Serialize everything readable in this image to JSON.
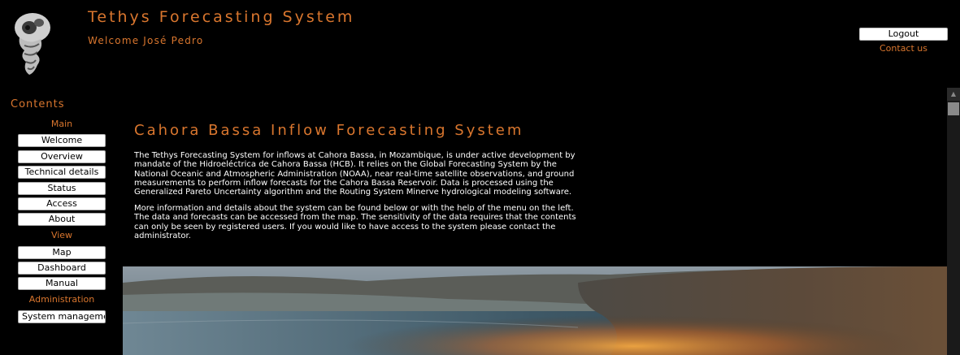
{
  "header": {
    "title": "Tethys Forecasting System",
    "welcome": "Welcome José Pedro",
    "logout_label": "Logout",
    "contact_label": "Contact us"
  },
  "sidebar": {
    "heading": "Contents",
    "groups": [
      {
        "label": "Main",
        "items": [
          "Welcome",
          "Overview",
          "Technical details",
          "Status",
          "Access",
          "About"
        ]
      },
      {
        "label": "View",
        "items": [
          "Map",
          "Dashboard",
          "Manual"
        ]
      },
      {
        "label": "Administration",
        "items": [
          "System management"
        ]
      }
    ]
  },
  "main": {
    "title": "Cahora Bassa Inflow Forecasting System",
    "paragraph1": "The Tethys Forecasting System for inflows at Cahora Bassa, in Mozambique, is under active development by mandate of the Hidroeléctrica de Cahora Bassa (HCB). It relies on the Global Forecasting System by the National Oceanic and Atmospheric Administration (NOAA), near real-time satellite observations, and ground measurements to perform inflow forecasts for the Cahora Bassa Reservoir. Data is processed using the Generalized Pareto Uncertainty algorithm and the Routing System Minerve hydrological modeling software.",
    "paragraph2": "More information and details about the system can be found below or with the help of the menu on the left. The data and forecasts can be accessed from the map. The sensitivity of the data requires that the contents can only be seen by registered users. If you would like to have access to the system please contact the administrator."
  },
  "colors": {
    "background": "#000000",
    "accent": "#d9762e",
    "button_bg": "#ffffff"
  },
  "icons": {
    "logo": "shell-fossil-logo",
    "scroll_up": "arrow-up-icon"
  }
}
